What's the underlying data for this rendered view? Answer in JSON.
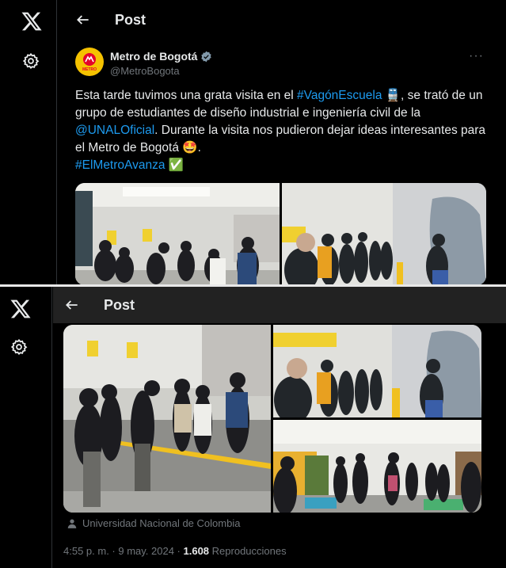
{
  "nav": {
    "logo_icon": "x-logo-icon",
    "settings_icon": "gear-icon"
  },
  "header": {
    "title": "Post",
    "back_icon": "arrow-left-icon"
  },
  "post": {
    "author_name": "Metro de Bogotá",
    "author_handle": "@MetroBogota",
    "more_label": "···",
    "avatar_label": "METRO",
    "text_1": "Esta tarde tuvimos una grata visita en el ",
    "hashtag_1": "#VagónEscuela",
    "text_2": " 🚆, se trató de un grupo de estudiantes de diseño industrial e ingeniería civil de la ",
    "mention": "@UNALOficial",
    "text_3": ". Durante la visita nos pudieron dejar ideas interesantes para el Metro de Bogotá 🤩.",
    "hashtag_2": "#ElMetroAvanza",
    "emoji_end": "✅",
    "location": "Universidad Nacional de Colombia",
    "time": "4:55 p. m. · 9 may. 2024 · ",
    "views_count": "1.608",
    "views_label": " Reproducciones"
  },
  "colors": {
    "accent": "#1d9bf0",
    "brand": "#f5c200",
    "muted": "#71767b"
  }
}
